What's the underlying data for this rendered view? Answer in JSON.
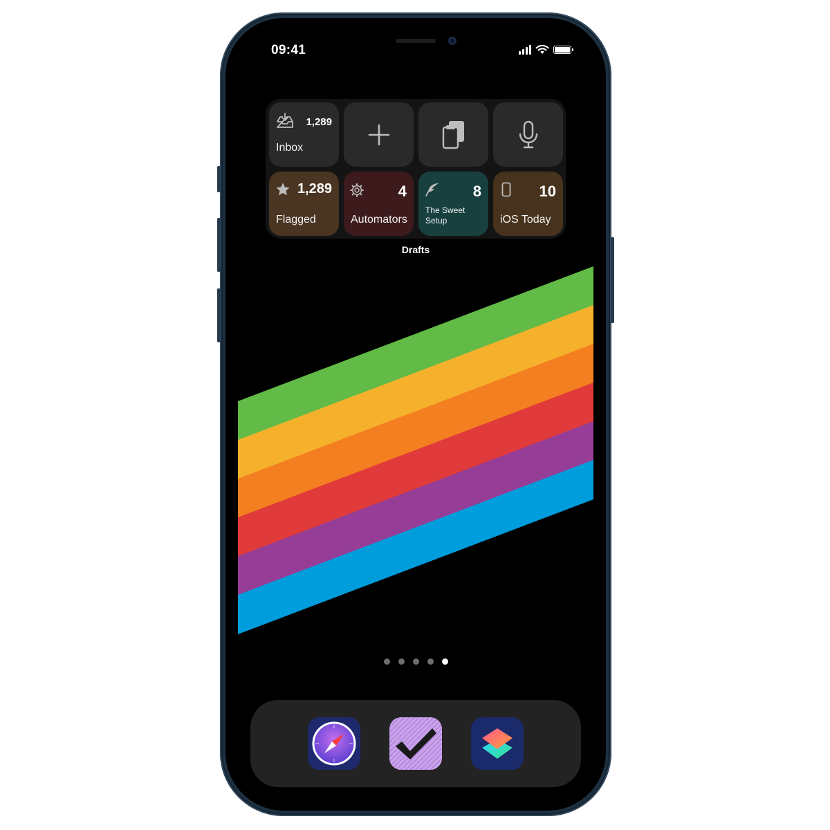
{
  "status_bar": {
    "time": "09:41",
    "signal_icon": "cellular-signal-icon",
    "wifi_icon": "wifi-icon",
    "battery_icon": "battery-full-icon"
  },
  "widget": {
    "app_name": "Drafts",
    "tiles_top": [
      {
        "id": "inbox",
        "icon": "inbox-tray-icon",
        "count": "1,289",
        "label": "Inbox"
      },
      {
        "id": "new-draft",
        "icon": "plus-icon"
      },
      {
        "id": "clipboard",
        "icon": "clipboard-copy-icon"
      },
      {
        "id": "dictate",
        "icon": "microphone-icon"
      }
    ],
    "tiles_bottom": [
      {
        "id": "flagged",
        "icon": "star-icon",
        "count": "1,289",
        "label": "Flagged",
        "color": "#4a3422"
      },
      {
        "id": "automators",
        "icon": "gear-icon",
        "count": "4",
        "label": "Automators",
        "color": "#3d1a1c"
      },
      {
        "id": "sweet-setup",
        "icon": "feather-icon",
        "count": "8",
        "label_line1": "The Sweet",
        "label_line2": "Setup",
        "color": "#17403f"
      },
      {
        "id": "ios-today",
        "icon": "phone-icon",
        "count": "10",
        "label": "iOS Today",
        "color": "#47331d"
      }
    ]
  },
  "wallpaper": {
    "stripe_colors": [
      "#62bb46",
      "#f6b12c",
      "#f47f20",
      "#e03b3a",
      "#963d97",
      "#009ddc"
    ]
  },
  "page_indicator": {
    "pages": 5,
    "current": 5
  },
  "dock": {
    "apps": [
      {
        "id": "safari",
        "icon": "compass-icon"
      },
      {
        "id": "omnifocus",
        "icon": "checkmark-icon"
      },
      {
        "id": "shortcuts",
        "icon": "shortcuts-layers-icon"
      }
    ]
  }
}
